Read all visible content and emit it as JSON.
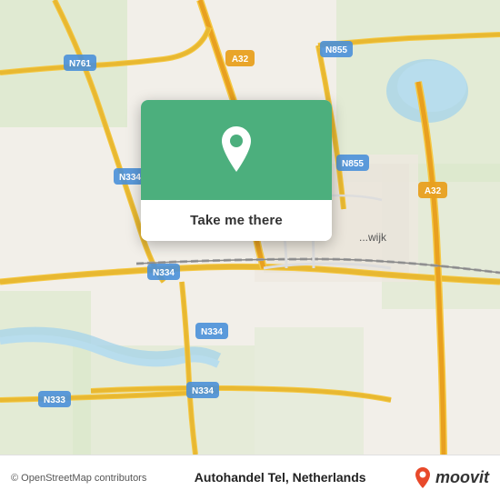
{
  "map": {
    "attribution": "© OpenStreetMap contributors",
    "location_name": "Autohandel Tel, Netherlands",
    "popup": {
      "button_label": "Take me there"
    }
  },
  "branding": {
    "moovit_label": "moovit"
  },
  "road_labels": [
    "N761",
    "A32",
    "N855",
    "N334",
    "N334",
    "N334",
    "N334",
    "N333",
    "A32"
  ]
}
